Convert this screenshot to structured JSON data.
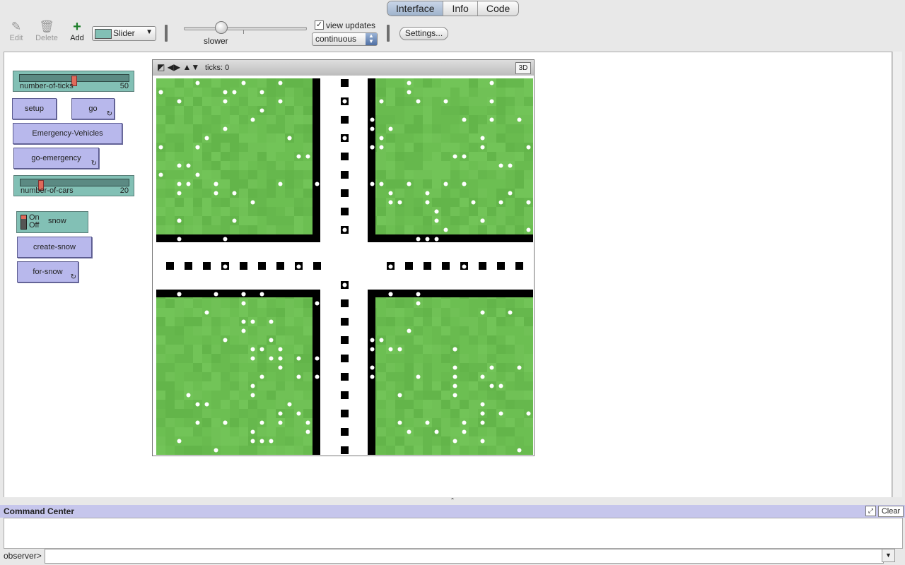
{
  "tabs": [
    {
      "label": "Interface",
      "active": true
    },
    {
      "label": "Info",
      "active": false
    },
    {
      "label": "Code",
      "active": false
    }
  ],
  "toolbar": {
    "edit_label": "Edit",
    "delete_label": "Delete",
    "add_label": "Add",
    "widget_type": "Slider",
    "speed_label": "slower",
    "view_updates_label": "view updates",
    "view_updates_checked": true,
    "update_mode": "continuous",
    "settings_label": "Settings..."
  },
  "widgets": {
    "ticks_slider": {
      "name": "number-of-ticks",
      "value": "50",
      "fraction": 0.5
    },
    "setup_button": "setup",
    "go_button": "go",
    "emergency_button": "Emergency-Vehicles",
    "go_emergency_button": "go-emergency",
    "cars_slider": {
      "name": "number-of-cars",
      "value": "20",
      "fraction": 0.18
    },
    "snow_switch": {
      "on_label": "On",
      "off_label": "Off",
      "name": "snow"
    },
    "create_snow_button": "create-snow",
    "for_snow_button": "for-snow"
  },
  "view": {
    "ticks_label": "ticks: 0",
    "button_3d": "3D",
    "colors": {
      "grass": "#6cbf52",
      "road": "#ffffff",
      "curb": "#000000",
      "snow": "#ffffff"
    }
  },
  "command_center": {
    "title": "Command Center",
    "clear_label": "Clear",
    "prompt": "observer>",
    "input_value": ""
  }
}
